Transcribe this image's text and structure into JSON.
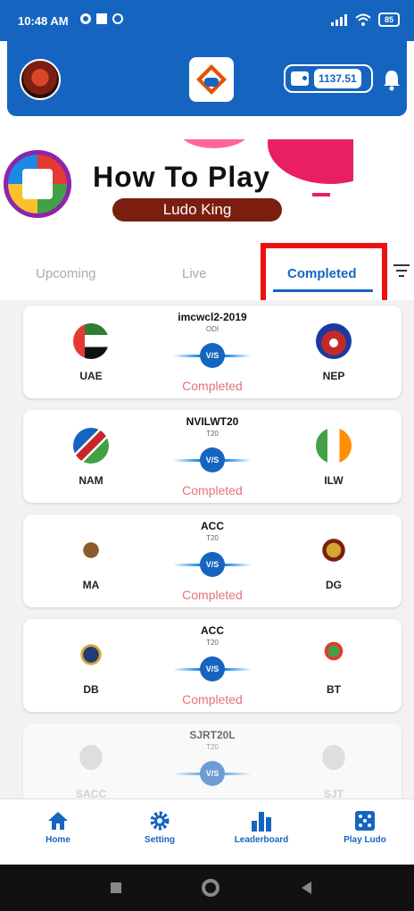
{
  "status_bar": {
    "time": "10:48 AM",
    "battery": "85"
  },
  "header": {
    "wallet_amount": "1137.51"
  },
  "banner": {
    "title": "How To Play",
    "subtitle": "Ludo King"
  },
  "tabs": [
    {
      "label": "Upcoming"
    },
    {
      "label": "Live"
    },
    {
      "label": "Completed"
    }
  ],
  "active_tab": "Completed",
  "matches": [
    {
      "series": "imcwcl2-2019",
      "format": "ODI",
      "team1": "UAE",
      "team2": "NEP",
      "status": "Completed",
      "vs": "V/S"
    },
    {
      "series": "NVILWT20",
      "format": "T20",
      "team1": "NAM",
      "team2": "ILW",
      "status": "Completed",
      "vs": "V/S"
    },
    {
      "series": "ACC",
      "format": "T20",
      "team1": "MA",
      "team2": "DG",
      "status": "Completed",
      "vs": "V/S"
    },
    {
      "series": "ACC",
      "format": "T20",
      "team1": "DB",
      "team2": "BT",
      "status": "Completed",
      "vs": "V/S"
    },
    {
      "series": "SJRT20L",
      "format": "T20",
      "team1": "SACC",
      "team2": "SJT",
      "status": "",
      "vs": "V/S"
    }
  ],
  "bottom_nav": [
    {
      "label": "Home",
      "icon": "home-icon"
    },
    {
      "label": "Setting",
      "icon": "gear-icon"
    },
    {
      "label": "Leaderboard",
      "icon": "bar-chart-icon"
    },
    {
      "label": "Play Ludo",
      "icon": "dice-icon"
    }
  ],
  "colors": {
    "primary": "#1565c0",
    "status_completed": "#e57373",
    "highlight": "#ee1111"
  }
}
